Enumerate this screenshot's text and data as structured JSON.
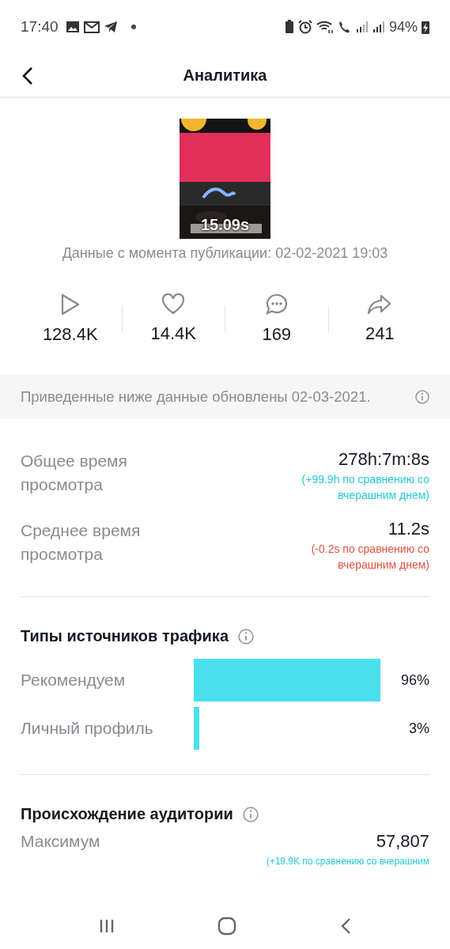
{
  "status_bar": {
    "time": "17:40",
    "battery": "94%"
  },
  "header": {
    "title": "Аналитика"
  },
  "video": {
    "kind": "picture",
    "duration": "15.09s"
  },
  "published": "Данные с момента публикации: 02-02-2021 19:03",
  "stats": [
    {
      "kind": "plays",
      "value": "128.4K"
    },
    {
      "kind": "likes",
      "value": "14.4K"
    },
    {
      "kind": "comments",
      "value": "169"
    },
    {
      "kind": "shares",
      "value": "241"
    }
  ],
  "notice": "Приведенные ниже данные обновлены 02-03-2021.",
  "metrics": [
    {
      "label": "Общее время просмотра",
      "value": "278h:7m:8s",
      "change": "(+99.9h по сравнению со вчерашним днем)",
      "kind": "increase"
    },
    {
      "label": "Среднее время просмотра",
      "value": "11.2s",
      "change": "(-0.2s по сравнению со вчерашним днем)",
      "kind": "decrease"
    }
  ],
  "traffic": {
    "title": "Типы источников трафика",
    "rows": [
      {
        "label": "Рекомендуем",
        "percent": "96%"
      },
      {
        "label": "Личный профиль",
        "percent": "3%"
      }
    ]
  },
  "audience": {
    "title": "Происхождение аудитории",
    "rows": [
      {
        "label": "Максимум",
        "value": "57,807",
        "change": "(+19.9K по сравнению со вчерашним",
        "kind": "increase"
      }
    ]
  }
}
